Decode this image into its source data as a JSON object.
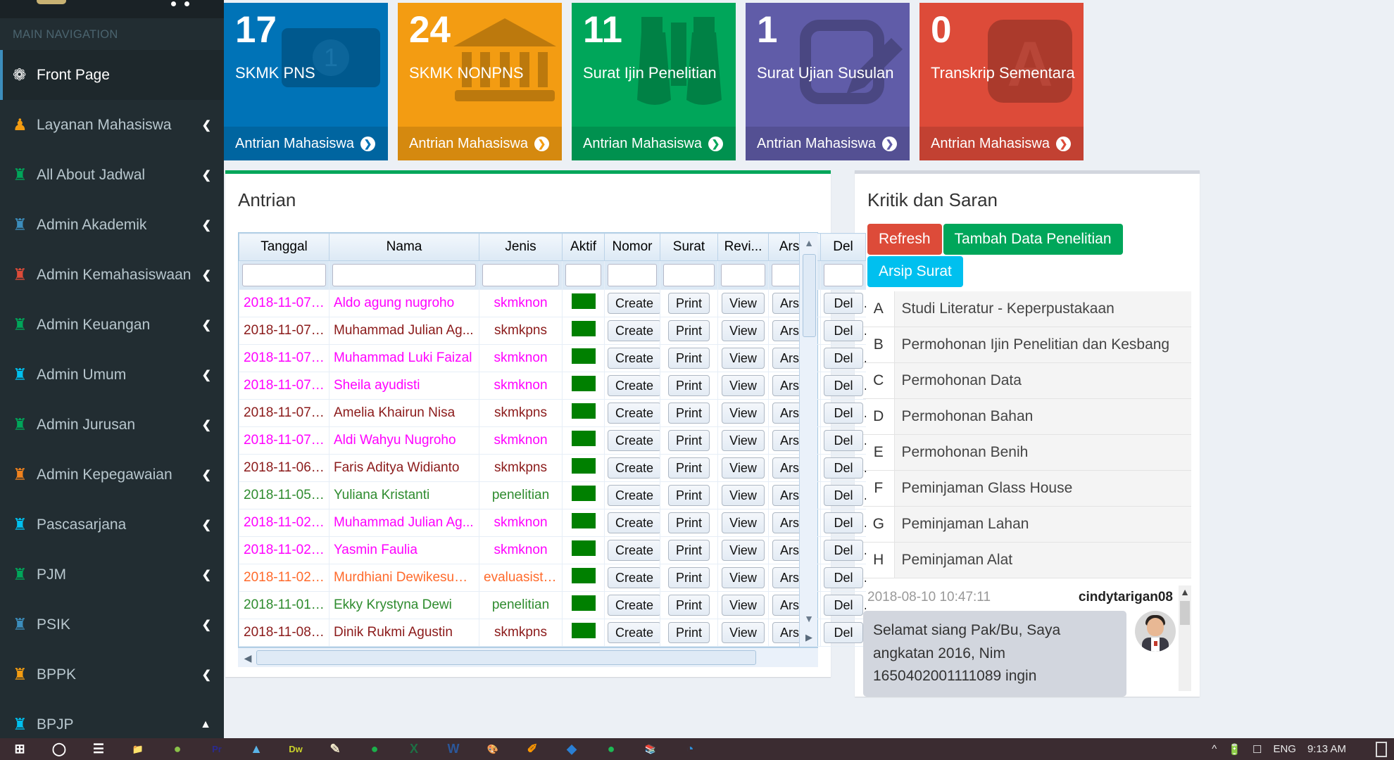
{
  "sidebar": {
    "header": "MAIN NAVIGATION",
    "items": [
      {
        "label": "Front Page",
        "icon": "dashboard-icon",
        "icon_glyph": "❁",
        "color": "#ffffff",
        "active": true,
        "arrow": ""
      },
      {
        "label": "Layanan Mahasiswa",
        "icon": "user-icon",
        "icon_glyph": "♟",
        "color": "#f39c12",
        "active": false,
        "arrow": "❮"
      },
      {
        "label": "All About Jadwal",
        "icon": "rook-icon",
        "icon_glyph": "♜",
        "color": "#00a65a",
        "active": false,
        "arrow": "❮"
      },
      {
        "label": "Admin Akademik",
        "icon": "rook-icon",
        "icon_glyph": "♜",
        "color": "#3c8dbc",
        "active": false,
        "arrow": "❮"
      },
      {
        "label": "Admin Kemahasiswaan",
        "icon": "rook-icon",
        "icon_glyph": "♜",
        "color": "#dd4b39",
        "active": false,
        "arrow": "❮"
      },
      {
        "label": "Admin Keuangan",
        "icon": "rook-icon",
        "icon_glyph": "♜",
        "color": "#00a65a",
        "active": false,
        "arrow": "❮"
      },
      {
        "label": "Admin Umum",
        "icon": "rook-icon",
        "icon_glyph": "♜",
        "color": "#00c0ef",
        "active": false,
        "arrow": "❮"
      },
      {
        "label": "Admin Jurusan",
        "icon": "rook-icon",
        "icon_glyph": "♜",
        "color": "#00a65a",
        "active": false,
        "arrow": "❮"
      },
      {
        "label": "Admin Kepegawaian",
        "icon": "rook-icon",
        "icon_glyph": "♜",
        "color": "#f0821e",
        "active": false,
        "arrow": "❮"
      },
      {
        "label": "Pascasarjana",
        "icon": "rook-icon",
        "icon_glyph": "♜",
        "color": "#00c0ef",
        "active": false,
        "arrow": "❮"
      },
      {
        "label": "PJM",
        "icon": "rook-icon",
        "icon_glyph": "♜",
        "color": "#00a65a",
        "active": false,
        "arrow": "❮"
      },
      {
        "label": "PSIK",
        "icon": "rook-icon",
        "icon_glyph": "♜",
        "color": "#3c8dbc",
        "active": false,
        "arrow": "❮"
      },
      {
        "label": "BPPK",
        "icon": "rook-icon",
        "icon_glyph": "♜",
        "color": "#f39c12",
        "active": false,
        "arrow": "❮"
      },
      {
        "label": "BPJP",
        "icon": "rook-icon",
        "icon_glyph": "♜",
        "color": "#00c0ef",
        "active": false,
        "arrow": "▲"
      }
    ]
  },
  "stats": [
    {
      "number": "17",
      "caption": "SKMK PNS",
      "link": "Antrian Mahasiswa",
      "color": "#0073b7",
      "icon": "money-icon"
    },
    {
      "number": "24",
      "caption": "SKMK NONPNS",
      "link": "Antrian Mahasiswa",
      "color": "#f39c12",
      "icon": "bank-icon"
    },
    {
      "number": "11",
      "caption": "Surat Ijin Penelitian",
      "link": "Antrian Mahasiswa",
      "color": "#00a65a",
      "icon": "binoculars-icon"
    },
    {
      "number": "1",
      "caption": "Surat Ujian Susulan",
      "link": "Antrian Mahasiswa",
      "color": "#605ca8",
      "icon": "pencil-square-icon"
    },
    {
      "number": "0",
      "caption": "Transkrip Sementara",
      "link": "Antrian Mahasiswa",
      "color": "#dd4b39",
      "icon": "file-pdf-icon"
    }
  ],
  "antrian": {
    "title": "Antrian",
    "columns": [
      "Tanggal",
      "Nama",
      "Jenis",
      "Aktif",
      "Nomor",
      "Surat",
      "Revi...",
      "Arsip",
      "Del"
    ],
    "filters": [
      "",
      "",
      "",
      "",
      "",
      "",
      "",
      "",
      ""
    ],
    "filter_placeholder": "",
    "actions": {
      "nomor": "Create",
      "surat": "Print",
      "revisi": "View",
      "arsip": "Arsip",
      "del": "Del"
    },
    "rows": [
      {
        "tanggal": "2018-11-07 ...",
        "nama": "Aldo agung nugroho",
        "jenis": "skmknon",
        "color": "#ff00ff"
      },
      {
        "tanggal": "2018-11-07 ...",
        "nama": "Muhammad Julian Ag...",
        "jenis": "skmkpns",
        "color": "#8b1a1a"
      },
      {
        "tanggal": "2018-11-07 ...",
        "nama": "Muhammad Luki Faizal",
        "jenis": "skmknon",
        "color": "#ff00ff"
      },
      {
        "tanggal": "2018-11-07 ...",
        "nama": "Sheila ayudisti",
        "jenis": "skmknon",
        "color": "#ff00ff"
      },
      {
        "tanggal": "2018-11-07 ...",
        "nama": "Amelia Khairun Nisa",
        "jenis": "skmkpns",
        "color": "#8b1a1a"
      },
      {
        "tanggal": "2018-11-07 ...",
        "nama": "Aldi Wahyu Nugroho",
        "jenis": "skmknon",
        "color": "#ff00ff"
      },
      {
        "tanggal": "2018-11-06 ...",
        "nama": "Faris Aditya Widianto",
        "jenis": "skmkpns",
        "color": "#8b1a1a"
      },
      {
        "tanggal": "2018-11-05 ...",
        "nama": "Yuliana Kristanti",
        "jenis": "penelitian",
        "color": "#2e8b2e"
      },
      {
        "tanggal": "2018-11-02 ...",
        "nama": "Muhammad Julian Ag...",
        "jenis": "skmknon",
        "color": "#ff00ff"
      },
      {
        "tanggal": "2018-11-02 ...",
        "nama": "Yasmin Faulia",
        "jenis": "skmknon",
        "color": "#ff00ff"
      },
      {
        "tanggal": "2018-11-02 ...",
        "nama": "Murdhiani Dewikesum...",
        "jenis": "evaluasistudi",
        "color": "#ff6a2b"
      },
      {
        "tanggal": "2018-11-01 ...",
        "nama": "Ekky Krystyna Dewi",
        "jenis": "penelitian",
        "color": "#2e8b2e"
      },
      {
        "tanggal": "2018-11-08 ...",
        "nama": "Dinik Rukmi Agustin",
        "jenis": "skmkpns",
        "color": "#8b1a1a"
      }
    ],
    "aktif_color": "#008000"
  },
  "kritik": {
    "title": "Kritik dan Saran",
    "buttons": [
      {
        "label": "Refresh",
        "style": "red"
      },
      {
        "label": "Tambah Data Penelitian",
        "style": "green"
      },
      {
        "label": "Arsip Surat",
        "style": "blue"
      }
    ],
    "list": [
      {
        "idx": "A",
        "text": "Studi Literatur - Keperpustakaan"
      },
      {
        "idx": "B",
        "text": "Permohonan Ijin Penelitian dan Kesbang"
      },
      {
        "idx": "C",
        "text": "Permohonan Data"
      },
      {
        "idx": "D",
        "text": "Permohonan Bahan"
      },
      {
        "idx": "E",
        "text": "Permohonan Benih"
      },
      {
        "idx": "F",
        "text": "Peminjaman Glass House"
      },
      {
        "idx": "G",
        "text": "Peminjaman Lahan"
      },
      {
        "idx": "H",
        "text": "Peminjaman Alat"
      }
    ],
    "comment": {
      "timestamp": "2018-08-10 10:47:11",
      "username": "cindytarigan08",
      "message": "Selamat siang Pak/Bu, Saya angkatan 2016, Nim 1650402001111089 ingin"
    }
  },
  "taskbar": {
    "language": "ENG",
    "time": "9:13 AM",
    "icons": [
      "start-windows-icon",
      "search-circle-icon",
      "task-view-icon",
      "file-explorer-icon",
      "android-studio-icon",
      "adobe-premiere-icon",
      "ccleaner-icon",
      "dreamweaver-icon",
      "notepad-icon",
      "teamviewer-icon",
      "excel-icon",
      "word-icon",
      "paint-icon",
      "sublime-icon",
      "photoshop-icon",
      "spotify-icon",
      "winrar-icon",
      "edge-icon"
    ],
    "tray": [
      "chevron-up-icon",
      "battery-icon",
      "network-icon"
    ]
  }
}
